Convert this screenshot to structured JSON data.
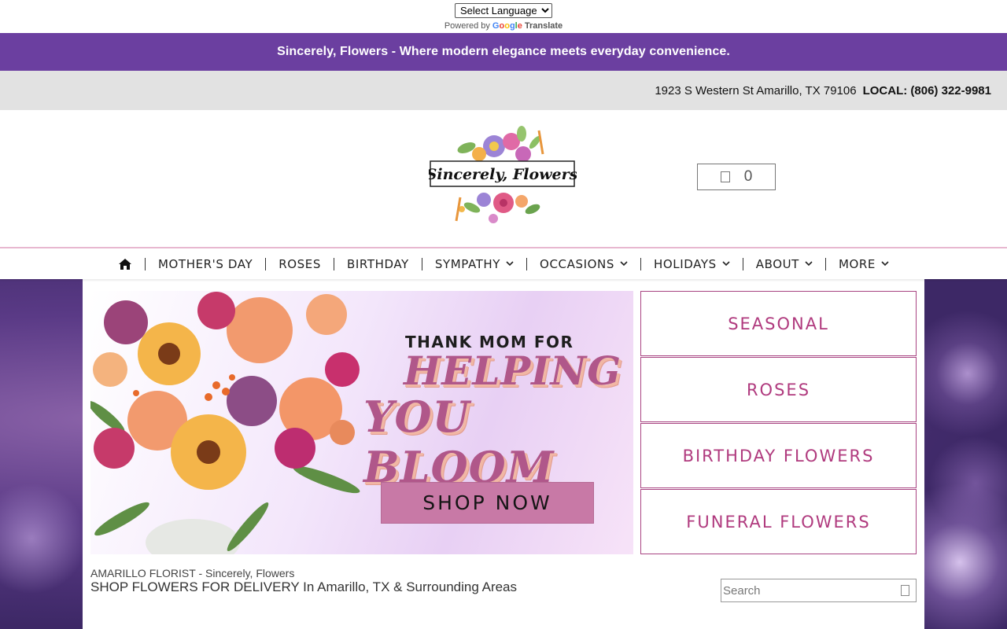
{
  "translate": {
    "select_label": "Select Language",
    "powered_by": "Powered by",
    "google": "Google",
    "translate_word": "Translate"
  },
  "banner": {
    "text": "Sincerely, Flowers - Where modern elegance meets everyday convenience."
  },
  "contact": {
    "address": "1923 S Western St Amarillo, TX 79106",
    "local": "LOCAL: (806) 322-9981"
  },
  "logo": {
    "text": "Sincerely, Flowers"
  },
  "cart": {
    "count": "0",
    "icon": "cart-icon"
  },
  "nav": {
    "items": [
      {
        "label": "MOTHER'S DAY",
        "dropdown": false
      },
      {
        "label": "ROSES",
        "dropdown": false
      },
      {
        "label": "BIRTHDAY",
        "dropdown": false
      },
      {
        "label": "SYMPATHY",
        "dropdown": true
      },
      {
        "label": "OCCASIONS",
        "dropdown": true
      },
      {
        "label": "HOLIDAYS",
        "dropdown": true
      },
      {
        "label": "ABOUT",
        "dropdown": true
      },
      {
        "label": "MORE",
        "dropdown": true
      }
    ]
  },
  "hero": {
    "line1": "THANK MOM FOR",
    "line2": "HELPING",
    "line3": "YOU BLOOM",
    "cta": "SHOP NOW"
  },
  "categories": [
    "SEASONAL",
    "ROSES",
    "BIRTHDAY FLOWERS",
    "FUNERAL FLOWERS"
  ],
  "intro": {
    "florist": "AMARILLO FLORIST - Sincerely, Flowers",
    "shop": "SHOP FLOWERS FOR DELIVERY In Amarillo, TX & Surrounding Areas"
  },
  "search": {
    "placeholder": "Search"
  },
  "colors": {
    "banner": "#6b3fa0",
    "accent": "#b03a7e",
    "cta": "#c879a6",
    "address_bar": "#e2e2e2"
  }
}
